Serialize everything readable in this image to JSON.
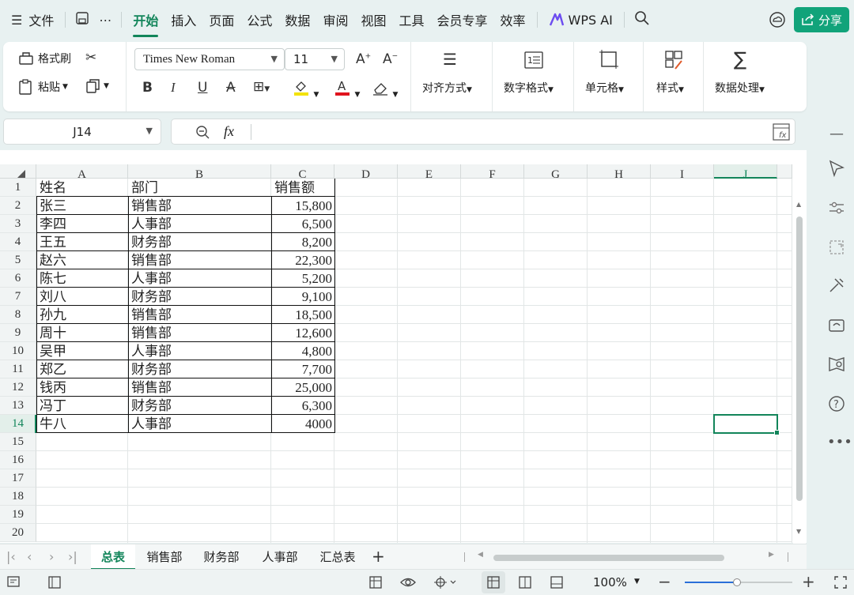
{
  "menu": {
    "file": "文件",
    "tabs": [
      "开始",
      "插入",
      "页面",
      "公式",
      "数据",
      "审阅",
      "视图",
      "工具",
      "会员专享",
      "效率"
    ],
    "active_tab": "开始",
    "wps_ai": "WPS AI",
    "share": "分享"
  },
  "ribbon": {
    "format_painter": "格式刷",
    "paste": "粘贴",
    "font_name": "Times New Roman",
    "font_size": "11",
    "align": "对齐方式",
    "number_format": "数字格式",
    "cells": "单元格",
    "styles": "样式",
    "data_processing": "数据处理"
  },
  "formula_bar": {
    "cell_ref": "J14",
    "fx": "fx",
    "content": ""
  },
  "grid": {
    "columns": [
      "A",
      "B",
      "C",
      "D",
      "E",
      "F",
      "G",
      "H",
      "I",
      "J"
    ],
    "selected_column": "J",
    "selected_row": "14",
    "row_numbers": [
      "1",
      "2",
      "3",
      "4",
      "5",
      "6",
      "7",
      "8",
      "9",
      "10",
      "11",
      "12",
      "13",
      "14",
      "15",
      "16",
      "17",
      "18",
      "19",
      "20"
    ],
    "rows": [
      [
        "姓名",
        "部门",
        "销售额"
      ],
      [
        "张三",
        "销售部",
        "15,800"
      ],
      [
        "李四",
        "人事部",
        "6,500"
      ],
      [
        "王五",
        "财务部",
        "8,200"
      ],
      [
        "赵六",
        "销售部",
        "22,300"
      ],
      [
        "陈七",
        "人事部",
        "5,200"
      ],
      [
        "刘八",
        "财务部",
        "9,100"
      ],
      [
        "孙九",
        "销售部",
        "18,500"
      ],
      [
        "周十",
        "销售部",
        "12,600"
      ],
      [
        "吴甲",
        "人事部",
        "4,800"
      ],
      [
        "郑乙",
        "财务部",
        "7,700"
      ],
      [
        "钱丙",
        "销售部",
        "25,000"
      ],
      [
        "冯丁",
        "财务部",
        "6,300"
      ],
      [
        "牛八",
        "人事部",
        "4000"
      ]
    ]
  },
  "sheets": [
    "总表",
    "销售部",
    "财务部",
    "人事部",
    "汇总表"
  ],
  "active_sheet": "总表",
  "status": {
    "zoom": "100%"
  },
  "colors": {
    "accent": "#12855a",
    "share_button": "#11a37a"
  }
}
